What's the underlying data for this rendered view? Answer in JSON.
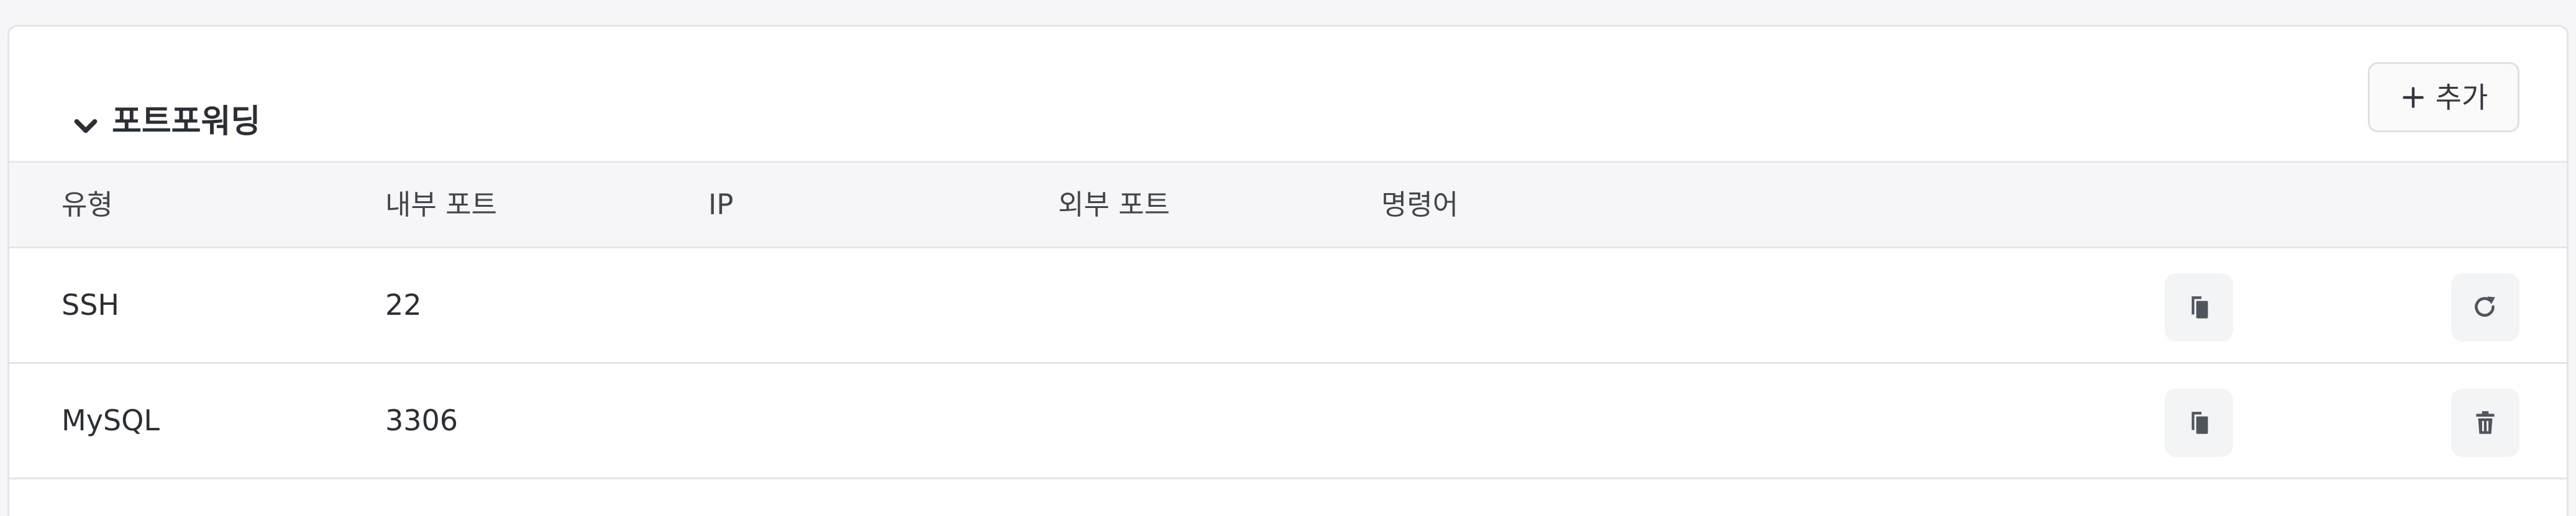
{
  "section": {
    "title": "포트포워딩",
    "add_button_label": "추가",
    "collapse_icon": "chevron-down-icon",
    "add_icon": "plus-icon"
  },
  "table": {
    "columns": [
      "유형",
      "내부 포트",
      "IP",
      "외부 포트",
      "명령어"
    ],
    "rows": [
      {
        "type": "SSH",
        "internal_port": "22",
        "ip": "",
        "external_port": "",
        "command": "",
        "copy_icon": "copy-icon",
        "action_icon": "refresh-icon"
      },
      {
        "type": "MySQL",
        "internal_port": "3306",
        "ip": "",
        "external_port": "",
        "command": "",
        "copy_icon": "copy-icon",
        "action_icon": "trash-icon"
      }
    ]
  },
  "colors": {
    "page_background": "#f6f6f8",
    "panel_background": "#ffffff",
    "header_row_background": "#f6f6f8",
    "border": "#e4e5e9",
    "text": "#2b2f33",
    "icon_button_background": "#f3f4f6",
    "icon": "#50555b"
  }
}
